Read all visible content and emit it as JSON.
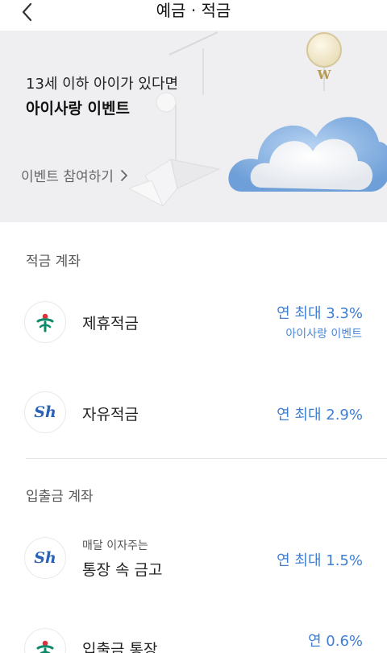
{
  "header": {
    "title": "예금 · 적금",
    "back_icon": "chevron-left-icon"
  },
  "banner": {
    "subtitle": "13세 이하 아이가 있다면",
    "title": "아이사랑 이벤트",
    "cta": "이벤트 참여하기",
    "cta_icon": "chevron-right-icon",
    "coin_logo": "W"
  },
  "sections": [
    {
      "title": "적금 계좌",
      "items": [
        {
          "name": "제휴적금",
          "rate": "연 최대 3.3%",
          "rate_note": "아이사랑 이벤트",
          "bank_icon": "hana-bank-icon"
        },
        {
          "name": "자유적금",
          "rate": "연 최대 2.9%",
          "bank_icon": "shinhan-bank-icon",
          "bank_text": "Sh"
        }
      ]
    },
    {
      "title": "입출금 계좌",
      "items": [
        {
          "small": "매달 이자주는",
          "name": "통장 속 금고",
          "rate": "연 최대 1.5%",
          "bank_icon": "shinhan-bank-icon",
          "bank_text": "Sh"
        },
        {
          "name": "입출금 통장",
          "rate": "연 0.6%",
          "bank_icon": "hana-bank-icon"
        }
      ]
    }
  ],
  "colors": {
    "accent": "#3f7fd4",
    "banner_bg": "#efeff1",
    "hana_green": "#0d8a6a",
    "hana_red": "#e0303a",
    "shinhan_blue": "#2a62b8"
  }
}
